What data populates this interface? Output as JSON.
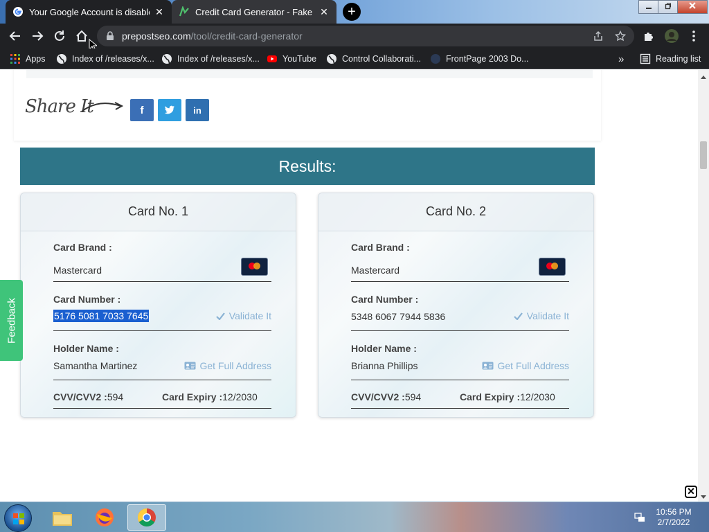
{
  "browser": {
    "tabs": [
      {
        "title": "Your Google Account is disabled",
        "close": "✕"
      },
      {
        "title": "Credit Card Generator - Fake cred",
        "close": "✕"
      }
    ],
    "new_tab": "+",
    "url": {
      "host": "prepostseo.com",
      "path": "/tool/credit-card-generator"
    },
    "bookmarks": [
      {
        "label": "Apps",
        "icon": "apps-grid-icon"
      },
      {
        "label": "Index of /releases/x...",
        "icon": "globe-icon"
      },
      {
        "label": "Index of /releases/x...",
        "icon": "globe-icon"
      },
      {
        "label": "YouTube",
        "icon": "youtube-icon"
      },
      {
        "label": "Control Collaborati...",
        "icon": "globe-icon"
      },
      {
        "label": "FrontPage 2003 Do...",
        "icon": "page-icon"
      }
    ],
    "bookmarks_overflow": "»",
    "reading_list": "Reading list"
  },
  "page": {
    "share_label": "Share It",
    "share_buttons": [
      {
        "label": "f",
        "color": "#3b6fb6"
      },
      {
        "label": "t",
        "color": "#2f9ee0"
      },
      {
        "label": "in",
        "color": "#2f6fb0"
      }
    ],
    "results_title": "Results:",
    "cards": [
      {
        "header": "Card No. 1",
        "brand_label": "Card Brand :",
        "brand_value": "Mastercard",
        "number_label": "Card Number :",
        "number_value": "5176 5081 7033 7645",
        "validate": "Validate It",
        "holder_label": "Holder Name :",
        "holder_value": "Samantha Martinez",
        "address": "Get Full Address",
        "cvv_label": "CVV/CVV2 :",
        "cvv_value": "594",
        "expiry_label": "Card Expiry :",
        "expiry_value": "12/2030"
      },
      {
        "header": "Card No. 2",
        "brand_label": "Card Brand :",
        "brand_value": "Mastercard",
        "number_label": "Card Number :",
        "number_value": "5348 6067 7944 5836",
        "validate": "Validate It",
        "holder_label": "Holder Name :",
        "holder_value": "Brianna Phillips",
        "address": "Get Full Address",
        "cvv_label": "CVV/CVV2 :",
        "cvv_value": "594",
        "expiry_label": "Card Expiry :",
        "expiry_value": "12/2030"
      }
    ],
    "feedback": "Feedback",
    "popup_close": "✕"
  },
  "taskbar": {
    "time": "10:56 PM",
    "date": "2/7/2022"
  },
  "colors": {
    "results_bar": "#2e7588",
    "action_link": "#8ab2d4",
    "feedback": "#3fc47a"
  }
}
